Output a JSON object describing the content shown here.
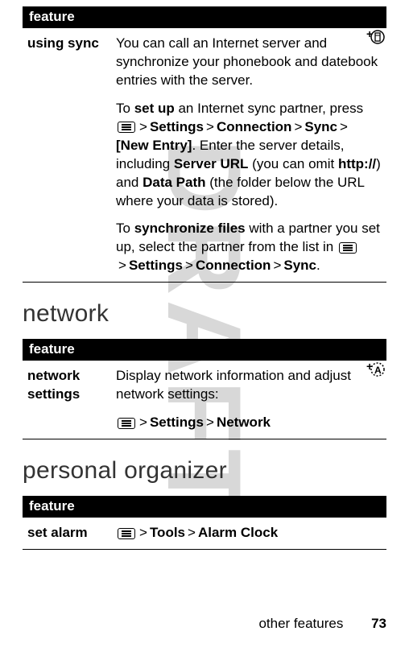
{
  "table1": {
    "header": "feature",
    "row": {
      "label": "using sync",
      "p1_a": "You can call an Internet server and synchronize your phonebook and datebook entries with the server.",
      "p2_a": "To ",
      "p2_b": "set up",
      "p2_c": " an Internet sync partner, press ",
      "p2_path1_a": "Settings",
      "p2_path1_b": "Connection",
      "p2_path1_c": "Sync",
      "p2_path1_d": "[New Entry]",
      "p2_d": ". Enter the server details, including ",
      "p2_e": "Server URL",
      "p2_f": " (you can omit ",
      "p2_g": "http://",
      "p2_h": ") and ",
      "p2_i": "Data Path",
      "p2_j": " (the folder below the URL where your data is stored).",
      "p3_a": "To ",
      "p3_b": "synchronize files",
      "p3_c": " with a partner you set up, select the partner from the list in ",
      "p3_path_a": "Settings",
      "p3_path_b": "Connection",
      "p3_path_c": "Sync",
      "p3_d": "."
    }
  },
  "section1": "network",
  "table2": {
    "header": "feature",
    "row": {
      "label": "network settings",
      "p1": "Display network information and adjust network settings:",
      "path_a": "Settings",
      "path_b": "Network"
    }
  },
  "section2": "personal organizer",
  "table3": {
    "header": "feature",
    "row": {
      "label": "set alarm",
      "path_a": "Tools",
      "path_b": "Alarm Clock"
    }
  },
  "footer": {
    "text": "other features",
    "page": "73"
  },
  "gt": ">"
}
